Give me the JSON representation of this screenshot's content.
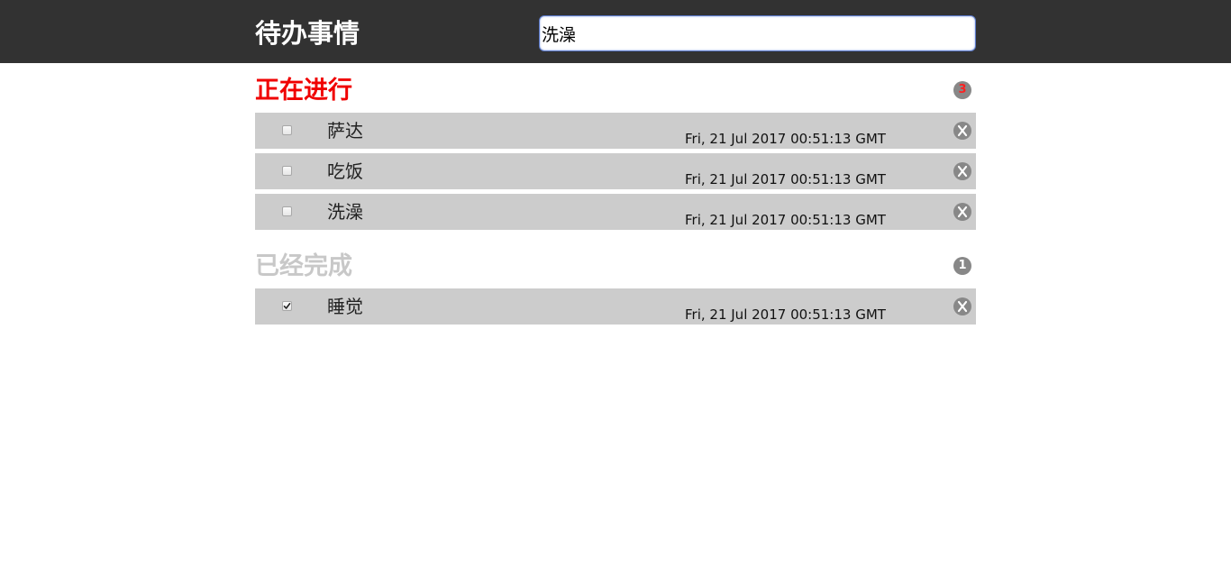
{
  "header": {
    "title": "待办事情",
    "search_value": "洗澡"
  },
  "active_section": {
    "title": "正在进行",
    "count": "3",
    "items": [
      {
        "text": "萨达",
        "time": "Fri, 21 Jul 2017 00:51:13 GMT",
        "checked": false
      },
      {
        "text": "吃饭",
        "time": "Fri, 21 Jul 2017 00:51:13 GMT",
        "checked": false
      },
      {
        "text": "洗澡",
        "time": "Fri, 21 Jul 2017 00:51:13 GMT",
        "checked": false
      }
    ]
  },
  "done_section": {
    "title": "已经完成",
    "count": "1",
    "items": [
      {
        "text": "睡觉",
        "time": "Fri, 21 Jul 2017 00:51:13 GMT",
        "checked": true
      }
    ]
  },
  "icons": {
    "delete": "close-x-icon",
    "checkmark": "check-icon"
  },
  "colors": {
    "header_bg": "#323232",
    "active_title": "#f00000",
    "done_title": "#c8c8c8",
    "row_bg": "#cccccc",
    "badge_bg": "#888888"
  }
}
